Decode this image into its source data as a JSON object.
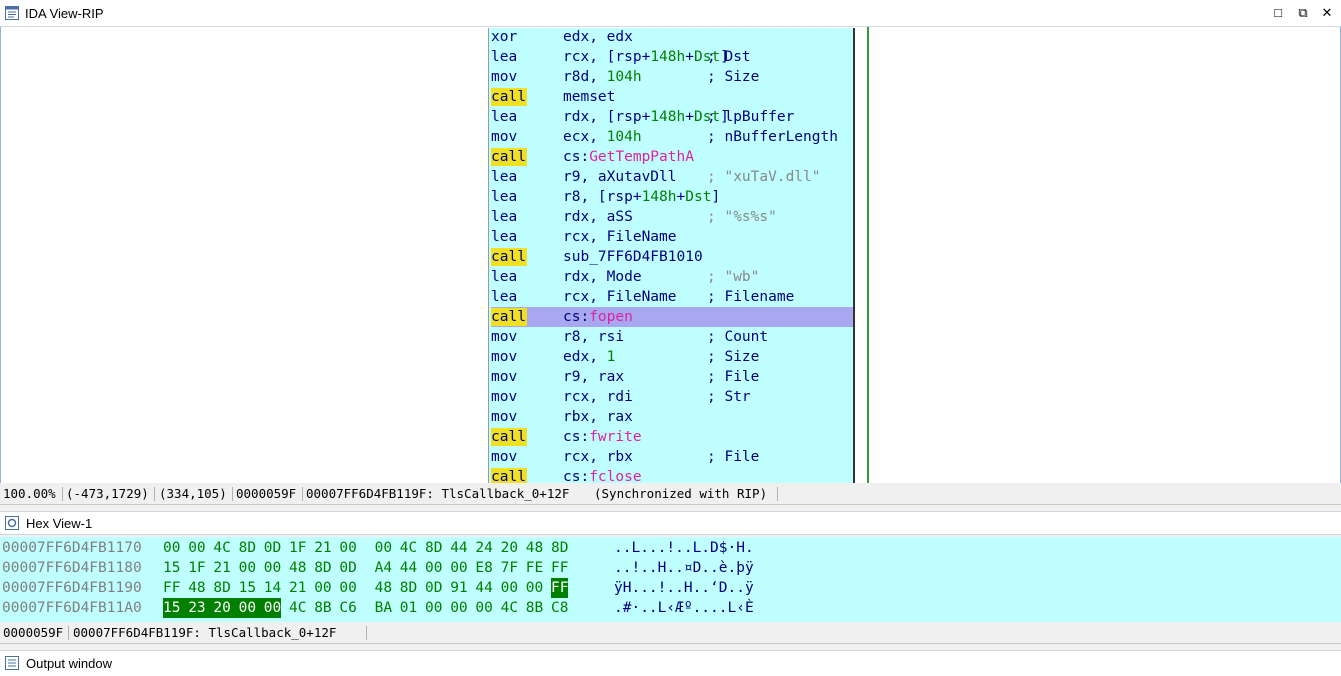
{
  "ida_view": {
    "title": "IDA View-RIP",
    "controls": {
      "minimize": "□",
      "restore": "⧉",
      "close": "✕"
    }
  },
  "code": [
    {
      "mnemonic": "xor",
      "operands": "edx, edx",
      "comment": ""
    },
    {
      "mnemonic": "lea",
      "operands": "rcx, [rsp+148h+Dst]",
      "comment": "; Dst"
    },
    {
      "mnemonic": "mov",
      "operands": "r8d, 104h",
      "comment": "; Size"
    },
    {
      "mnemonic": "call",
      "operands": "memset",
      "comment": ""
    },
    {
      "mnemonic": "lea",
      "operands": "rdx, [rsp+148h+Dst]",
      "comment": "; lpBuffer"
    },
    {
      "mnemonic": "mov",
      "operands": "ecx, 104h",
      "comment": "; nBufferLength"
    },
    {
      "mnemonic": "call",
      "operands": "cs:GetTempPathA",
      "comment": ""
    },
    {
      "mnemonic": "lea",
      "operands": "r9, aXutavDll",
      "comment": "; \"xuTaV.dll\""
    },
    {
      "mnemonic": "lea",
      "operands": "r8, [rsp+148h+Dst]",
      "comment": ""
    },
    {
      "mnemonic": "lea",
      "operands": "rdx, aSS",
      "comment": "; \"%s%s\""
    },
    {
      "mnemonic": "lea",
      "operands": "rcx, FileName",
      "comment": ""
    },
    {
      "mnemonic": "call",
      "operands": "sub_7FF6D4FB1010",
      "comment": ""
    },
    {
      "mnemonic": "lea",
      "operands": "rdx, Mode",
      "comment": "; \"wb\""
    },
    {
      "mnemonic": "lea",
      "operands": "rcx, FileName",
      "comment": "; Filename"
    },
    {
      "mnemonic": "call",
      "operands": "cs:fopen",
      "comment": ""
    },
    {
      "mnemonic": "mov",
      "operands": "r8, rsi",
      "comment": "; Count"
    },
    {
      "mnemonic": "mov",
      "operands": "edx, 1",
      "comment": "; Size"
    },
    {
      "mnemonic": "mov",
      "operands": "r9, rax",
      "comment": "; File"
    },
    {
      "mnemonic": "mov",
      "operands": "rcx, rdi",
      "comment": "; Str"
    },
    {
      "mnemonic": "mov",
      "operands": "rbx, rax",
      "comment": ""
    },
    {
      "mnemonic": "call",
      "operands": "cs:fwrite",
      "comment": ""
    },
    {
      "mnemonic": "mov",
      "operands": "rcx, rbx",
      "comment": "; File"
    },
    {
      "mnemonic": "call",
      "operands": "cs:fclose",
      "comment": ""
    }
  ],
  "highlighted_line": 14,
  "status1": {
    "zoom": "100.00%",
    "coords": "(-473,1729)",
    "size": "(334,105)",
    "offset": "0000059F",
    "location": "00007FF6D4FB119F: TlsCallback_0+12F",
    "sync": "(Synchronized with RIP)"
  },
  "hex_view": {
    "title": "Hex View-1",
    "rows": [
      {
        "address": "00007FF6D4FB1170",
        "bytes": [
          "00",
          "00",
          "4C",
          "8D",
          "0D",
          "1F",
          "21",
          "00",
          "00",
          "4C",
          "8D",
          "44",
          "24",
          "20",
          "48",
          "8D"
        ],
        "ascii": "..L...!..L.D$·H."
      },
      {
        "address": "00007FF6D4FB1180",
        "bytes": [
          "15",
          "1F",
          "21",
          "00",
          "00",
          "48",
          "8D",
          "0D",
          "A4",
          "44",
          "00",
          "00",
          "E8",
          "7F",
          "FE",
          "FF"
        ],
        "ascii": "..!..H..¤D..è.þÿ"
      },
      {
        "address": "00007FF6D4FB1190",
        "bytes": [
          "FF",
          "48",
          "8D",
          "15",
          "14",
          "21",
          "00",
          "00",
          "48",
          "8D",
          "0D",
          "91",
          "44",
          "00",
          "00",
          "FF"
        ],
        "ascii": "ÿH...!..H..‘D..ÿ"
      },
      {
        "address": "00007FF6D4FB11A0",
        "bytes": [
          "15",
          "23",
          "20",
          "00",
          "00",
          "4C",
          "8B",
          "C6",
          "BA",
          "01",
          "00",
          "00",
          "00",
          "4C",
          "8B",
          "C8"
        ],
        "ascii": ".#·..L‹Æº....L‹È"
      }
    ],
    "selection": "00007FF6D4FB119F"
  },
  "status2": {
    "offset": "0000059F",
    "location": "00007FF6D4FB119F: TlsCallback_0+12F"
  },
  "output_window": {
    "title": "Output window"
  }
}
